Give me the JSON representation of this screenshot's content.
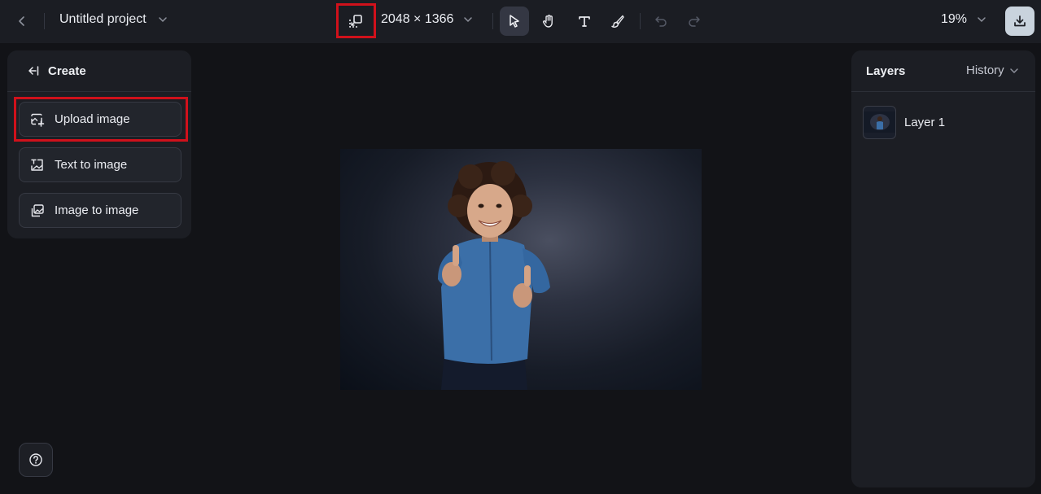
{
  "topbar": {
    "project_title": "Untitled project",
    "dimensions": "2048 × 1366",
    "zoom": "19%"
  },
  "create_panel": {
    "title": "Create",
    "options": [
      {
        "label": "Upload image",
        "icon": "upload-image-icon"
      },
      {
        "label": "Text to image",
        "icon": "text-to-image-icon"
      },
      {
        "label": "Image to image",
        "icon": "image-to-image-icon"
      }
    ]
  },
  "layers_panel": {
    "title": "Layers",
    "history_tab": "History",
    "layers": [
      {
        "label": "Layer 1"
      }
    ]
  },
  "colors": {
    "background": "#121317",
    "panel": "#1c1e24",
    "highlight": "#d0111b",
    "active_tool": "#343743",
    "download_button": "#c9d3dd"
  },
  "icons": [
    "back-icon",
    "chevron-down-icon",
    "resize-icon",
    "select-cursor-icon",
    "hand-icon",
    "text-icon",
    "brush-icon",
    "undo-icon",
    "redo-icon",
    "download-icon",
    "help-icon"
  ]
}
